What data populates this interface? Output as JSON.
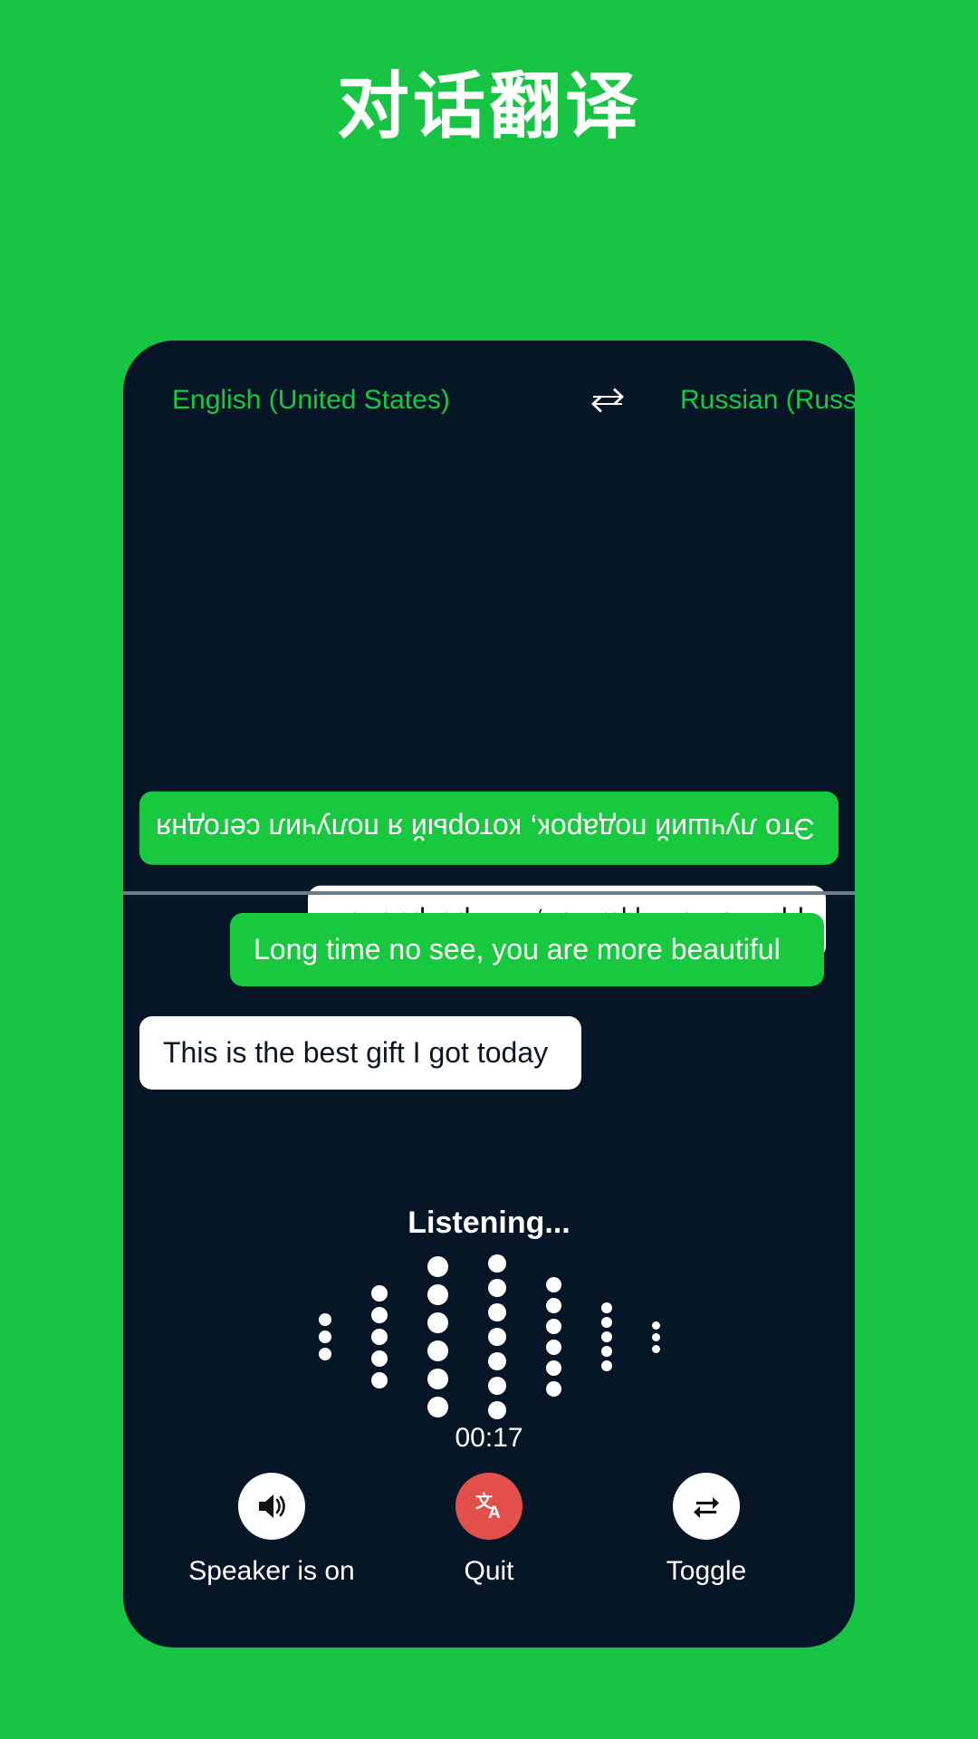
{
  "header": {
    "title": "对话翻译"
  },
  "language_bar": {
    "source": "English (United States)",
    "target": "Russian (Russia)",
    "swap_icon": "swap-horizontal-icon"
  },
  "conversation": {
    "top_pane": {
      "orientation": "rotated-180",
      "messages": [
        {
          "speaker": "remote",
          "style": "green",
          "text": "Это лучший подарок, который я получил сегодня"
        },
        {
          "speaker": "remote",
          "style": "white",
          "text": "Давно не виделись, ты прекрасней"
        }
      ]
    },
    "bottom_pane": {
      "orientation": "normal",
      "messages": [
        {
          "speaker": "local",
          "style": "green",
          "text": "Long time no see, you are more beautiful"
        },
        {
          "speaker": "local",
          "style": "white",
          "text": "This is the best gift I got today"
        }
      ]
    }
  },
  "recording": {
    "status_label": "Listening...",
    "timer": "00:17",
    "waveform": {
      "columns": [
        {
          "dots": 3,
          "size": 14
        },
        {
          "dots": 5,
          "size": 18
        },
        {
          "dots": 6,
          "size": 23
        },
        {
          "dots": 7,
          "size": 20
        },
        {
          "dots": 6,
          "size": 17
        },
        {
          "dots": 5,
          "size": 12
        },
        {
          "dots": 3,
          "size": 9
        }
      ]
    }
  },
  "controls": [
    {
      "label": "Speaker is on",
      "icon": "speaker-on-icon",
      "circle": "white"
    },
    {
      "label": "Quit",
      "icon": "translate-icon",
      "circle": "red"
    },
    {
      "label": "Toggle",
      "icon": "swap-vertical-arrows-icon",
      "circle": "white"
    }
  ],
  "colors": {
    "background": "#17c443",
    "card": "#061626",
    "accent_green": "#18c93f",
    "quit_red": "#e34f4a",
    "divider": "#6f7d87",
    "white": "#ffffff"
  }
}
